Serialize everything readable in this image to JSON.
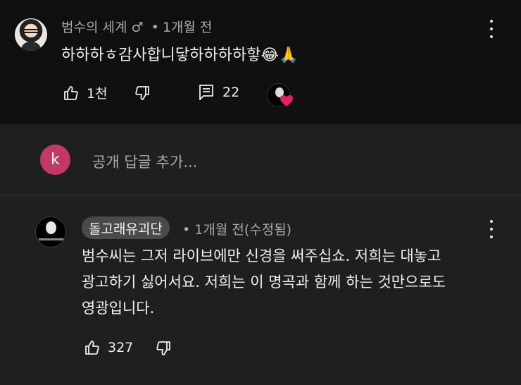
{
  "top_comment": {
    "author": "범수의 세계",
    "author_badge": "♂",
    "time": "1개월 전",
    "text": "하하하ㅎ감사합니닿하하하하핳😂🙏",
    "likes": "1천",
    "replies": "22"
  },
  "reply_box": {
    "avatar_letter": "k",
    "placeholder": "공개 답글 추가..."
  },
  "reply_comment": {
    "author": "돌고래유괴단",
    "time": "1개월 전(수정됨)",
    "text_lines": [
      "범수씨는 그저 라이브에만 신경을 써주십쇼. 저희는 대놓고",
      "광고하기 싫어서요. 저희는 이 명곡과 함께 하는 것만으로도",
      "영광입니다."
    ],
    "likes": "327"
  },
  "colors": {
    "background": "#0f0f0f",
    "panel": "#1f1f1f",
    "avatar_k": "#c23a63",
    "heart": "#e0245e"
  }
}
